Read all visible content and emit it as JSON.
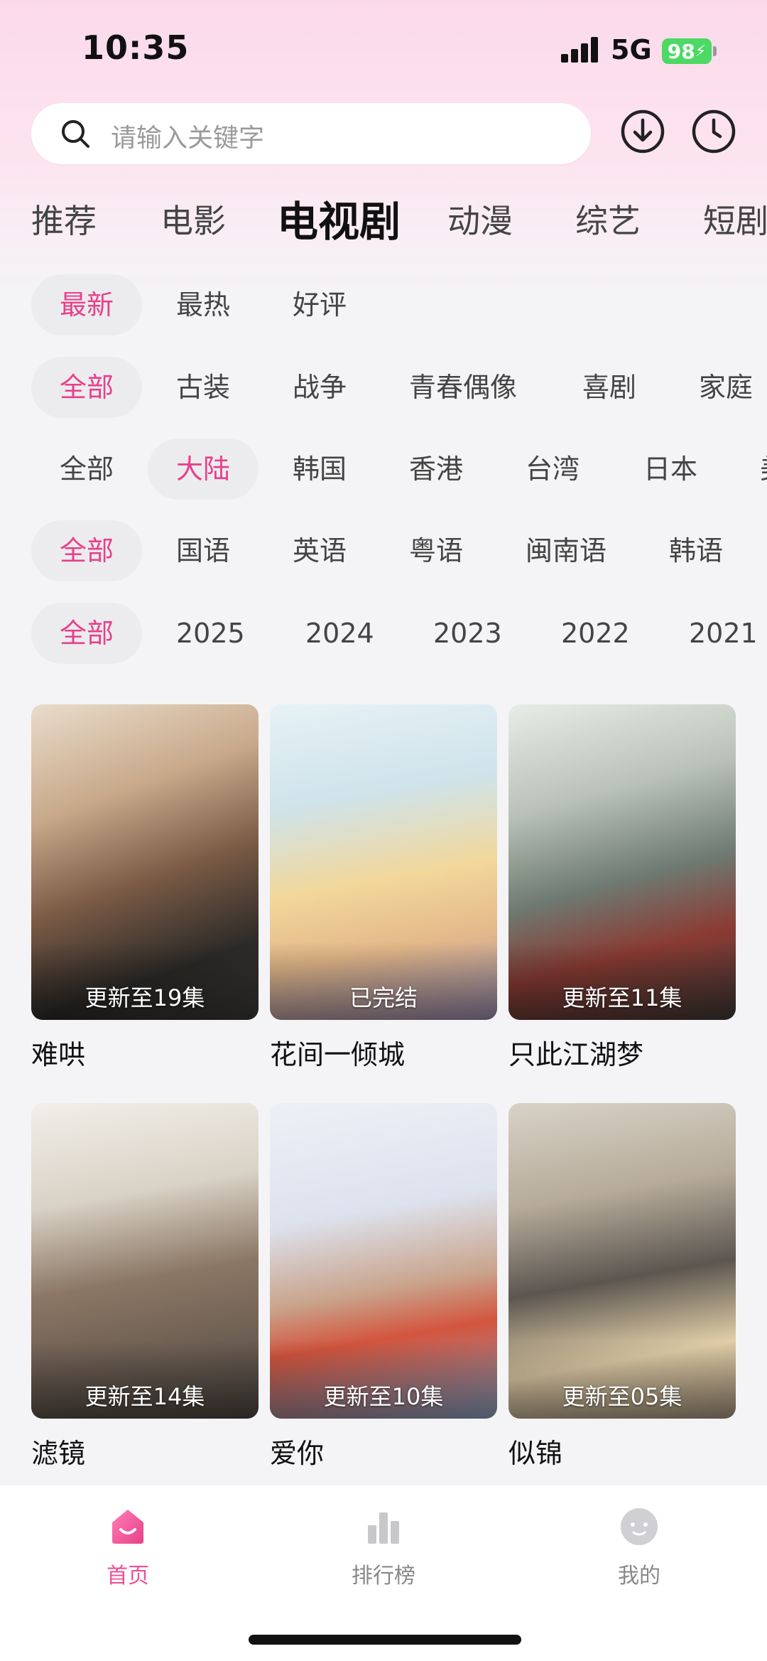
{
  "status_bar": {
    "time": "10:35",
    "network": "5G",
    "battery": "98"
  },
  "search": {
    "placeholder": "请输入关键字"
  },
  "categories": [
    "推荐",
    "电影",
    "电视剧",
    "动漫",
    "综艺",
    "短剧"
  ],
  "filters": {
    "sort": [
      "最新",
      "最热",
      "好评"
    ],
    "genre": [
      "全部",
      "古装",
      "战争",
      "青春偶像",
      "喜剧",
      "家庭"
    ],
    "region": [
      "全部",
      "大陆",
      "韩国",
      "香港",
      "台湾",
      "日本",
      "美"
    ],
    "language": [
      "全部",
      "国语",
      "英语",
      "粤语",
      "闽南语",
      "韩语"
    ],
    "year": [
      "全部",
      "2025",
      "2024",
      "2023",
      "2022",
      "2021"
    ]
  },
  "shows": [
    {
      "title": "难哄",
      "badge": "更新至19集"
    },
    {
      "title": "花间一倾城",
      "badge": "已完结"
    },
    {
      "title": "只此江湖梦",
      "badge": "更新至11集"
    },
    {
      "title": "滤镜",
      "badge": "更新至14集"
    },
    {
      "title": "爱你",
      "badge": "更新至10集"
    },
    {
      "title": "似锦",
      "badge": "更新至05集"
    }
  ],
  "nav": [
    {
      "label": "首页"
    },
    {
      "label": "排行榜"
    },
    {
      "label": "我的"
    }
  ],
  "colors": {
    "accent": "#e8408a",
    "nav_active": "#ef4f95",
    "battery": "#4cd964"
  }
}
